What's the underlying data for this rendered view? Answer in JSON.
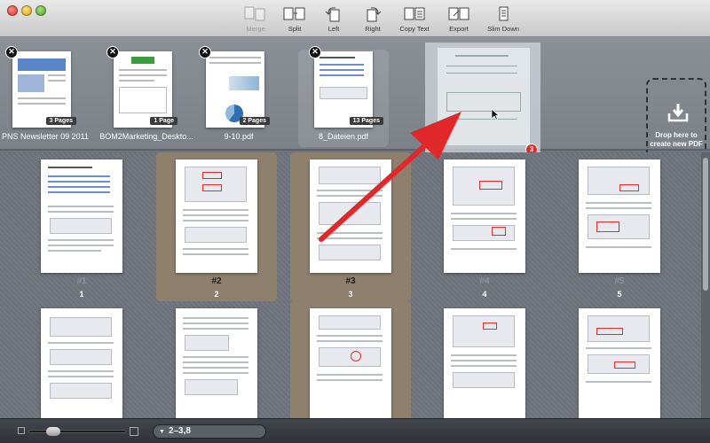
{
  "toolbar": {
    "items": [
      {
        "label": "Merge",
        "icon": "merge-icon",
        "enabled": false
      },
      {
        "label": "Split",
        "icon": "split-icon",
        "enabled": true
      },
      {
        "label": "Left",
        "icon": "rotate-left-icon",
        "enabled": true
      },
      {
        "label": "Right",
        "icon": "rotate-right-icon",
        "enabled": true
      },
      {
        "label": "Copy Text",
        "icon": "copy-text-icon",
        "enabled": true
      },
      {
        "label": "Export",
        "icon": "export-icon",
        "enabled": true
      },
      {
        "label": "Slim Down",
        "icon": "slim-down-icon",
        "enabled": true
      }
    ]
  },
  "shelf": {
    "documents": [
      {
        "name": "PNS Newsletter 09 2011",
        "pages": "3 Pages"
      },
      {
        "name": "BOM2Marketing_Deskto...",
        "pages": "1 Page"
      },
      {
        "name": "9-10.pdf",
        "pages": "2 Pages"
      },
      {
        "name": "8_Dateien.pdf",
        "pages": "13 Pages"
      }
    ],
    "drag_count": "3",
    "dropzone_label": "Drop here to create new PDF",
    "close_glyph": "✕"
  },
  "grid": {
    "pages": [
      {
        "label": "#1",
        "number": "1",
        "selected": false
      },
      {
        "label": "#2",
        "number": "2",
        "selected": true
      },
      {
        "label": "#3",
        "number": "3",
        "selected": true
      },
      {
        "label": "#4",
        "number": "4",
        "selected": false
      },
      {
        "label": "#5",
        "number": "5",
        "selected": false
      },
      {
        "label": "",
        "number": "",
        "selected": false
      },
      {
        "label": "",
        "number": "",
        "selected": false
      },
      {
        "label": "",
        "number": "",
        "selected": true
      },
      {
        "label": "",
        "number": "",
        "selected": false
      },
      {
        "label": "",
        "number": "",
        "selected": false
      }
    ]
  },
  "bottombar": {
    "selection_range": "2–3,8",
    "zoom_level": 0.2
  },
  "colors": {
    "selection": "#8e806c",
    "arrow": "#e0282a",
    "badge": "#e0282a"
  }
}
